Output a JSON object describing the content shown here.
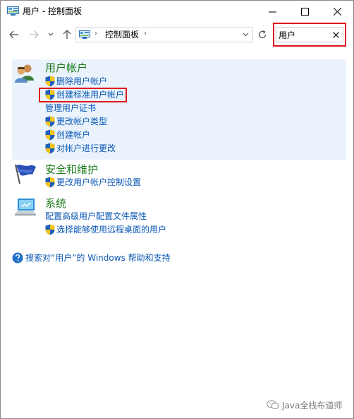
{
  "window": {
    "title": "用户 - 控制面板"
  },
  "address_bar": {
    "path": "控制面板"
  },
  "search": {
    "value": "用户"
  },
  "groups": [
    {
      "title": "用户帐户",
      "links": [
        {
          "label": "删除用户帐户",
          "shield": true
        },
        {
          "label": "创建标准用户帐户",
          "shield": true,
          "highlighted": true
        },
        {
          "label": "管理用户证书",
          "shield": false
        },
        {
          "label": "更改帐户类型",
          "shield": true
        },
        {
          "label": "创建帐户",
          "shield": true
        },
        {
          "label": "对帐户进行更改",
          "shield": true
        }
      ]
    },
    {
      "title": "安全和维护",
      "links": [
        {
          "label": "更改用户帐户控制设置",
          "shield": true
        }
      ]
    },
    {
      "title": "系统",
      "links": [
        {
          "label": "配置高级用户配置文件属性",
          "shield": false
        },
        {
          "label": "选择能够使用远程桌面的用户",
          "shield": true
        }
      ]
    }
  ],
  "help": {
    "label": "搜索对“用户”的 Windows 帮助和支持"
  },
  "watermark": {
    "label": "Java全栈布道师"
  },
  "colors": {
    "link": "#0a57b5",
    "group_title": "#1e7d1e",
    "highlight": "#e0161c",
    "panel_bg": "#eaf3fc"
  },
  "icons": {
    "title": "control-panel-icon",
    "users_group": "users-icon",
    "security_group": "flag-icon",
    "system_group": "computer-icon",
    "uac": "uac-shield-icon",
    "help": "help-icon",
    "watermark": "wechat-icon"
  }
}
